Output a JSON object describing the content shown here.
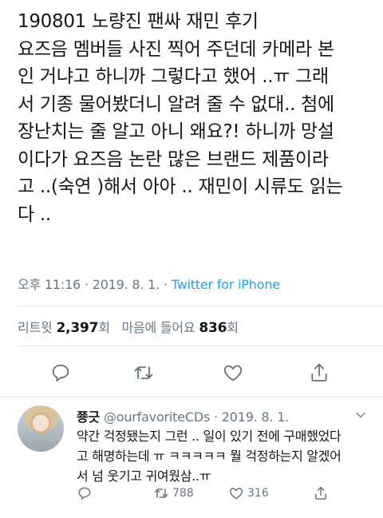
{
  "tweet": {
    "lines": [
      "190801 노량진 팬싸 재민 후기",
      "요즈음 멤버들 사진 찍어 주던데 카메라 본",
      "인 거냐고 하니까 그렇다고 했어 ..ㅠ 그래",
      "서 기종 물어봤더니 알려 줄 수 없대.. 첨에",
      "장난치는 줄 알고 아니 왜요?! 하니까 망설",
      "이다가 요즈음 논란 많은 브랜드 제품이라",
      "고 ..(숙연 )해서 아아 .. 재민이 시류도 읽는",
      "다 .."
    ],
    "time": "오후 11:16",
    "date": "2019. 8. 1.",
    "source": "Twitter for iPhone",
    "retweet_label": "리트윗",
    "retweet_count": "2,397",
    "retweet_suffix": "회",
    "like_label": "마음에 들어요",
    "like_count": "836",
    "like_suffix": "회"
  },
  "icons": {
    "reply": "comment-icon",
    "retweet": "retweet-icon",
    "like": "heart-icon",
    "share": "share-icon",
    "more": "chevron-down-icon"
  },
  "reply": {
    "name": "쭁긋",
    "handle": "@ourfavoriteCDs",
    "date": "2019. 8. 1.",
    "lines": [
      "약간 걱정됐는지 그런 .. 일이 있기 전에 구매했었다",
      "고 해명하는데 ㅠ ㅋㅋㅋㅋㅋ 뭘 걱정하는지 알겠어",
      "서 넘 웃기고 귀여웠삼..ㅠ"
    ],
    "retweet_count": "788",
    "like_count": "316"
  },
  "colors": {
    "link": "#1da1f2",
    "secondary": "#657786",
    "divider": "#e1e8ed"
  }
}
